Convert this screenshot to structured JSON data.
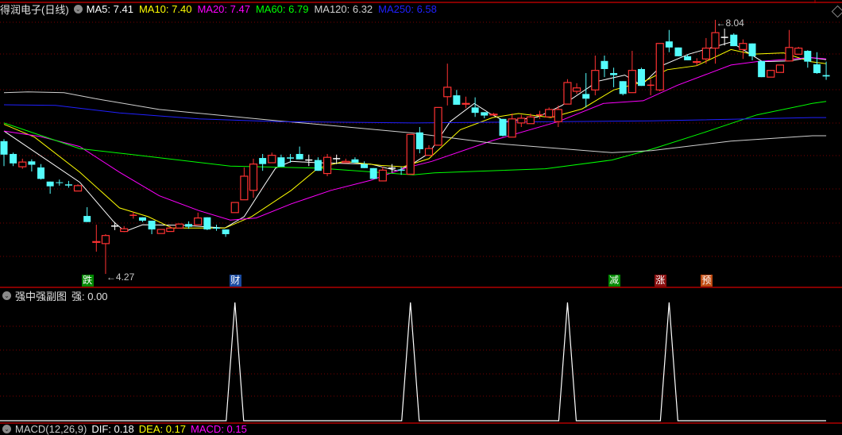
{
  "header": {
    "stock_title": "得润电子(日线)",
    "ma": [
      {
        "label": "MA5: 7.41",
        "color": "#ffffff"
      },
      {
        "label": "MA10: 7.40",
        "color": "#ffff00"
      },
      {
        "label": "MA20: 7.47",
        "color": "#ff00ff"
      },
      {
        "label": "MA60: 6.79",
        "color": "#00ff00"
      },
      {
        "label": "MA120: 6.32",
        "color": "#d0d0d0"
      },
      {
        "label": "MA250: 6.58",
        "color": "#2020ff"
      }
    ]
  },
  "price_labels": {
    "high": "8.04",
    "low": "4.27"
  },
  "markers": [
    {
      "text": "跌",
      "color": "#008800",
      "index": 9
    },
    {
      "text": "财",
      "color": "#1a4aa0",
      "index": 25
    },
    {
      "text": "减",
      "color": "#008800",
      "index": 66
    },
    {
      "text": "涨",
      "color": "#8b1010",
      "index": 71
    },
    {
      "text": "预",
      "color": "#c04a10",
      "index": 76
    }
  ],
  "sub_panel": {
    "title": "强中强副图",
    "value_label": "强: 0.00",
    "spikes": [
      25,
      44,
      61,
      72
    ],
    "spike_value": 1
  },
  "macd": {
    "title": "MACD(12,26,9)",
    "dif": "DIF: 0.18",
    "dea": "DEA: 0.17",
    "macd": "MACD: 0.15"
  },
  "colors": {
    "up": "#ff3232",
    "down": "#54fcfc",
    "grid": "#7a0000",
    "separator": "#b00000"
  },
  "chart_data": {
    "type": "candlestick",
    "price_range": [
      4.27,
      8.04
    ],
    "candles_ohlc_as_open_close_high_low": [
      [
        6.24,
        6.04,
        6.27,
        5.87
      ],
      [
        6.05,
        5.91,
        6.07,
        5.87
      ],
      [
        5.86,
        5.93,
        5.98,
        5.83
      ],
      [
        5.94,
        5.89,
        5.97,
        5.79
      ],
      [
        5.85,
        5.68,
        5.9,
        5.67
      ],
      [
        5.64,
        5.57,
        5.64,
        5.46
      ],
      [
        5.63,
        5.62,
        5.67,
        5.58
      ],
      [
        5.59,
        5.59,
        5.65,
        5.55
      ],
      [
        5.5,
        5.58,
        5.6,
        5.5
      ],
      [
        5.13,
        5.04,
        5.26,
        5.04
      ],
      [
        4.74,
        4.75,
        5.0,
        4.6
      ],
      [
        4.72,
        4.84,
        4.86,
        4.27
      ],
      [
        4.98,
        4.98,
        5.04,
        4.92
      ],
      [
        4.9,
        4.94,
        4.98,
        4.89
      ],
      [
        5.14,
        5.14,
        5.19,
        5.09
      ],
      [
        5.11,
        5.06,
        5.11,
        5.04
      ],
      [
        5.06,
        4.93,
        5.06,
        4.86
      ],
      [
        4.87,
        4.93,
        4.93,
        4.87
      ],
      [
        4.9,
        4.95,
        4.98,
        4.9
      ],
      [
        4.95,
        5.01,
        5.02,
        4.95
      ],
      [
        5.01,
        4.97,
        5.05,
        4.94
      ],
      [
        5.0,
        5.1,
        5.18,
        5.0
      ],
      [
        5.11,
        4.93,
        5.11,
        4.92
      ],
      [
        4.95,
        4.95,
        5.0,
        4.91
      ],
      [
        4.93,
        4.86,
        4.93,
        4.82
      ],
      [
        5.18,
        5.33,
        5.33,
        5.18
      ],
      [
        5.37,
        5.72,
        5.85,
        5.37
      ],
      [
        5.51,
        5.9,
        5.98,
        5.4
      ],
      [
        5.99,
        5.9,
        6.05,
        5.8
      ],
      [
        5.92,
        6.03,
        6.07,
        5.92
      ],
      [
        6.0,
        5.86,
        6.04,
        5.86
      ],
      [
        5.99,
        5.99,
        6.05,
        5.92
      ],
      [
        6.05,
        5.97,
        6.16,
        5.97
      ],
      [
        5.96,
        5.96,
        6.04,
        5.87
      ],
      [
        5.96,
        5.8,
        6.0,
        5.8
      ],
      [
        5.76,
        6.0,
        6.05,
        5.72
      ],
      [
        5.98,
        5.98,
        6.04,
        5.9
      ],
      [
        5.92,
        5.94,
        5.98,
        5.92
      ],
      [
        5.97,
        5.92,
        6.0,
        5.92
      ],
      [
        5.9,
        5.84,
        5.94,
        5.84
      ],
      [
        5.84,
        5.68,
        5.84,
        5.68
      ],
      [
        5.65,
        5.81,
        5.86,
        5.65
      ],
      [
        5.84,
        5.84,
        5.9,
        5.78
      ],
      [
        5.81,
        5.81,
        5.86,
        5.74
      ],
      [
        5.75,
        6.34,
        6.34,
        5.75
      ],
      [
        6.37,
        6.12,
        6.45,
        6.06
      ],
      [
        6.03,
        6.13,
        6.18,
        6.03
      ],
      [
        6.18,
        6.74,
        6.74,
        6.18
      ],
      [
        6.9,
        7.04,
        7.39,
        6.77
      ],
      [
        6.92,
        6.78,
        7.0,
        6.78
      ],
      [
        6.79,
        6.8,
        6.9,
        6.73
      ],
      [
        6.74,
        6.66,
        6.89,
        6.6
      ],
      [
        6.67,
        6.62,
        6.67,
        6.58
      ],
      [
        6.63,
        6.64,
        6.66,
        6.62
      ],
      [
        6.57,
        6.32,
        6.57,
        6.31
      ],
      [
        6.3,
        6.57,
        6.65,
        6.3
      ],
      [
        6.51,
        6.58,
        6.63,
        6.45
      ],
      [
        6.5,
        6.6,
        6.65,
        6.5
      ],
      [
        6.63,
        6.63,
        6.69,
        6.57
      ],
      [
        6.6,
        6.71,
        6.74,
        6.6
      ],
      [
        6.53,
        6.71,
        6.77,
        6.45
      ],
      [
        6.79,
        7.11,
        7.16,
        6.79
      ],
      [
        6.98,
        7.03,
        7.1,
        6.94
      ],
      [
        6.94,
        6.87,
        7.25,
        6.74
      ],
      [
        7.0,
        7.29,
        7.51,
        6.92
      ],
      [
        7.43,
        7.31,
        7.51,
        7.19
      ],
      [
        7.25,
        7.22,
        7.33,
        7.04
      ],
      [
        7.13,
        6.94,
        7.13,
        6.92
      ],
      [
        6.96,
        7.29,
        7.58,
        6.96
      ],
      [
        7.31,
        7.06,
        7.33,
        7.06
      ],
      [
        7.07,
        7.07,
        7.16,
        6.92
      ],
      [
        7.0,
        7.69,
        7.69,
        6.98
      ],
      [
        7.72,
        7.63,
        7.89,
        7.56
      ],
      [
        7.63,
        7.5,
        7.63,
        7.5
      ],
      [
        7.5,
        7.44,
        7.53,
        7.44
      ],
      [
        7.41,
        7.42,
        7.47,
        7.36
      ],
      [
        7.46,
        7.62,
        7.77,
        7.39
      ],
      [
        7.62,
        7.85,
        8.04,
        7.39
      ],
      [
        7.78,
        7.78,
        7.91,
        7.66
      ],
      [
        7.82,
        7.65,
        7.84,
        7.65
      ],
      [
        7.6,
        7.69,
        7.75,
        7.46
      ],
      [
        7.69,
        7.5,
        7.69,
        7.44
      ],
      [
        7.43,
        7.19,
        7.43,
        7.19
      ],
      [
        7.19,
        7.29,
        7.29,
        7.19
      ],
      [
        7.26,
        7.37,
        7.37,
        7.26
      ],
      [
        7.43,
        7.63,
        7.89,
        7.43
      ],
      [
        7.53,
        7.62,
        7.64,
        7.53
      ],
      [
        7.58,
        7.42,
        7.59,
        7.33
      ],
      [
        7.38,
        7.25,
        7.56,
        7.24
      ],
      [
        7.22,
        7.2,
        7.42,
        7.15
      ]
    ],
    "ma_lines_index_price": {
      "MA5": [
        [
          0,
          6.39
        ],
        [
          8.2,
          5.63
        ],
        [
          11.9,
          5.04
        ],
        [
          13.1,
          4.9
        ],
        [
          15,
          5.0
        ],
        [
          19.6,
          4.99
        ],
        [
          23.9,
          4.95
        ],
        [
          26,
          5.12
        ],
        [
          28.2,
          5.59
        ],
        [
          29.4,
          5.84
        ],
        [
          31.1,
          5.94
        ],
        [
          34,
          5.92
        ],
        [
          39.7,
          5.9
        ],
        [
          42.6,
          5.8
        ],
        [
          44.3,
          5.91
        ],
        [
          46,
          6.06
        ],
        [
          48.3,
          6.53
        ],
        [
          50.9,
          6.8
        ],
        [
          52.6,
          6.65
        ],
        [
          54.3,
          6.53
        ],
        [
          57.8,
          6.6
        ],
        [
          60.4,
          6.77
        ],
        [
          64.3,
          7.13
        ],
        [
          67.2,
          7.22
        ],
        [
          69,
          7.07
        ],
        [
          71.2,
          7.36
        ],
        [
          74.1,
          7.53
        ],
        [
          78.7,
          7.71
        ],
        [
          80.1,
          7.59
        ],
        [
          82.1,
          7.42
        ],
        [
          85,
          7.43
        ],
        [
          87.3,
          7.48
        ],
        [
          89,
          7.45
        ]
      ],
      "MA10": [
        [
          0,
          6.49
        ],
        [
          3.3,
          6.3
        ],
        [
          8.2,
          5.78
        ],
        [
          12.5,
          5.25
        ],
        [
          15.6,
          5.12
        ],
        [
          18.2,
          4.95
        ],
        [
          23.9,
          4.95
        ],
        [
          26.8,
          5.12
        ],
        [
          31.1,
          5.51
        ],
        [
          34,
          5.84
        ],
        [
          36.8,
          5.94
        ],
        [
          40.8,
          5.88
        ],
        [
          43.2,
          5.86
        ],
        [
          46,
          5.98
        ],
        [
          49.4,
          6.41
        ],
        [
          52.9,
          6.59
        ],
        [
          55.7,
          6.65
        ],
        [
          59.2,
          6.59
        ],
        [
          62.6,
          6.72
        ],
        [
          66,
          7.0
        ],
        [
          69.2,
          7.12
        ],
        [
          71.8,
          7.3
        ],
        [
          75,
          7.36
        ],
        [
          78.7,
          7.6
        ],
        [
          81,
          7.53
        ],
        [
          84.4,
          7.55
        ],
        [
          87.3,
          7.42
        ],
        [
          89,
          7.39
        ]
      ],
      "MA20": [
        [
          0,
          6.39
        ],
        [
          3.9,
          6.31
        ],
        [
          8.2,
          6.16
        ],
        [
          12.5,
          5.78
        ],
        [
          16.8,
          5.43
        ],
        [
          21.1,
          5.21
        ],
        [
          24.5,
          5.07
        ],
        [
          27.3,
          5.1
        ],
        [
          31.1,
          5.31
        ],
        [
          35.4,
          5.51
        ],
        [
          39.7,
          5.66
        ],
        [
          43.4,
          5.84
        ],
        [
          46.3,
          5.94
        ],
        [
          52.9,
          6.25
        ],
        [
          60,
          6.53
        ],
        [
          64.9,
          6.8
        ],
        [
          69.2,
          6.84
        ],
        [
          72.9,
          7.07
        ],
        [
          78.7,
          7.37
        ],
        [
          81.5,
          7.42
        ],
        [
          87.3,
          7.48
        ],
        [
          89,
          7.46
        ]
      ],
      "MA60": [
        [
          0,
          6.51
        ],
        [
          8.2,
          6.13
        ],
        [
          13.9,
          6.04
        ],
        [
          24.5,
          5.87
        ],
        [
          34,
          5.84
        ],
        [
          44.3,
          5.74
        ],
        [
          46.6,
          5.77
        ],
        [
          58.6,
          5.83
        ],
        [
          65.8,
          5.96
        ],
        [
          70.1,
          6.12
        ],
        [
          75.8,
          6.37
        ],
        [
          81.5,
          6.63
        ],
        [
          87.5,
          6.8
        ],
        [
          89,
          6.83
        ]
      ],
      "MA120": [
        [
          0,
          6.96
        ],
        [
          2.6,
          6.97
        ],
        [
          6.5,
          6.96
        ],
        [
          9.9,
          6.87
        ],
        [
          16.8,
          6.71
        ],
        [
          29.7,
          6.54
        ],
        [
          34,
          6.49
        ],
        [
          44.3,
          6.36
        ],
        [
          52.9,
          6.21
        ],
        [
          65.8,
          6.07
        ],
        [
          70.1,
          6.1
        ],
        [
          78.7,
          6.24
        ],
        [
          87.5,
          6.32
        ],
        [
          89,
          6.32
        ]
      ],
      "MA250": [
        [
          0,
          6.78
        ],
        [
          5.6,
          6.77
        ],
        [
          12.5,
          6.66
        ],
        [
          21.1,
          6.57
        ],
        [
          29.7,
          6.53
        ],
        [
          44.3,
          6.51
        ],
        [
          60,
          6.53
        ],
        [
          70.1,
          6.54
        ],
        [
          87.5,
          6.59
        ],
        [
          89,
          6.59
        ]
      ]
    }
  }
}
